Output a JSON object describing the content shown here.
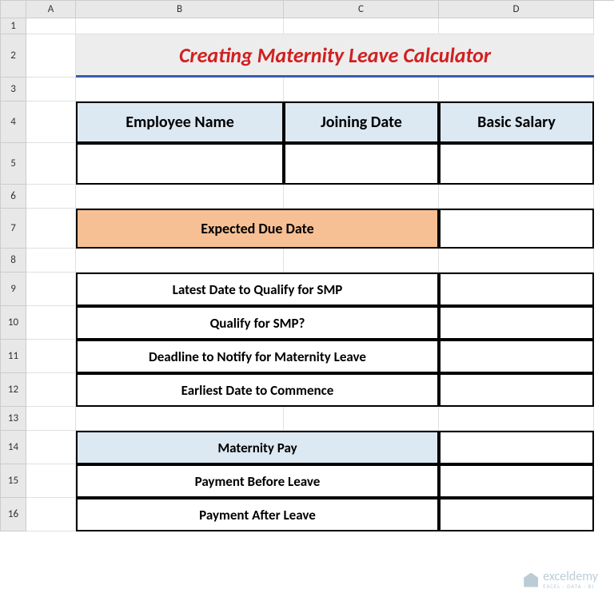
{
  "columns": [
    "A",
    "B",
    "C",
    "D"
  ],
  "rows": [
    "1",
    "2",
    "3",
    "4",
    "5",
    "6",
    "7",
    "8",
    "9",
    "10",
    "11",
    "12",
    "13",
    "14",
    "15",
    "16"
  ],
  "title": "Creating Maternity Leave Calculator",
  "employee_header": {
    "name": "Employee Name",
    "joining": "Joining Date",
    "salary": "Basic Salary"
  },
  "due_date_label": "Expected Due Date",
  "smp": {
    "latest_date": "Latest Date to Qualify for SMP",
    "qualify": "Qualify for SMP?",
    "deadline": "Deadline to Notify for Maternity Leave",
    "earliest": "Earliest Date to Commence"
  },
  "pay": {
    "header": "Maternity Pay",
    "before": "Payment Before Leave",
    "after": "Payment After Leave"
  },
  "watermark": {
    "main": "exceldemy",
    "sub": "EXCEL · DATA · BI"
  }
}
